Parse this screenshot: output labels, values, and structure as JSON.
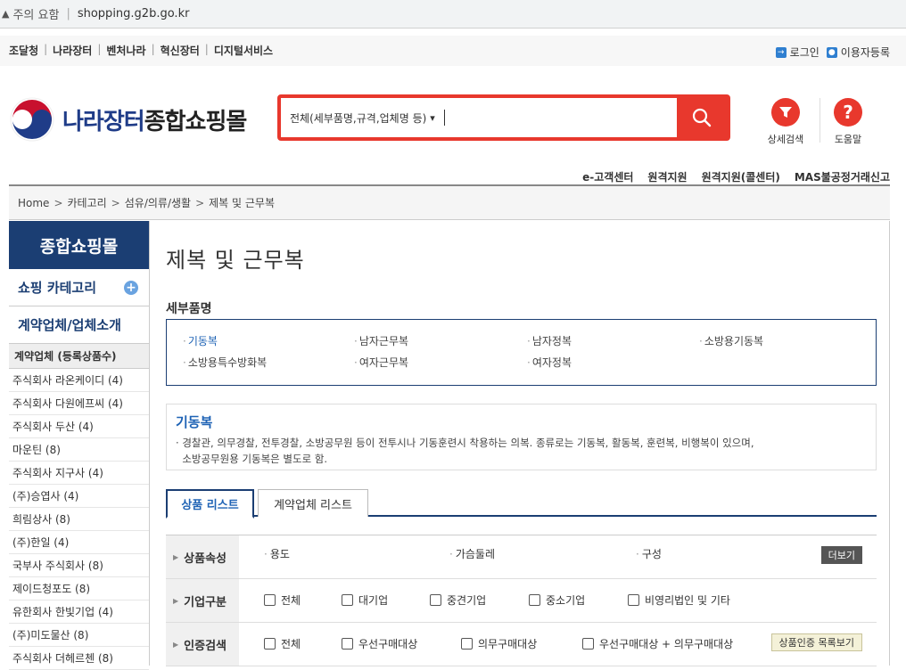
{
  "browser": {
    "warning": "주의 요함",
    "url": "shopping.g2b.go.kr"
  },
  "util": {
    "links": [
      "조달청",
      "나라장터",
      "벤처나라",
      "혁신장터",
      "디지털서비스"
    ],
    "login": "로그인",
    "register": "이용자등록"
  },
  "header": {
    "logo_blue": "나라장터",
    "logo_black": "종합쇼핑몰",
    "search_scope": "전체(세부품명,규격,업체명 등)",
    "search_value": "",
    "detail_search": "상세검색",
    "help": "도움말"
  },
  "sublinks": [
    "e-고객센터",
    "원격지원",
    "원격지원(콜센터)",
    "MAS불공정거래신고"
  ],
  "breadcrumb": [
    "Home",
    "카테고리",
    "섬유/의류/생활",
    "제복 및 근무복"
  ],
  "sidebar": {
    "title": "종합쇼핑몰",
    "category": "쇼핑 카테고리",
    "contract": "계약업체/업체소개",
    "list_header": "계약업체 (등록상품수)",
    "vendors": [
      "주식회사 라온케이디 (4)",
      "주식회사 다원에프씨 (4)",
      "주식회사 두산 (4)",
      "마운틴 (8)",
      "주식회사 지구사 (4)",
      "(주)승엽사 (4)",
      "희림상사 (8)",
      "(주)한일 (4)",
      "국부사 주식회사 (8)",
      "제이드청포도 (8)",
      "유한회사 한빛기업 (4)",
      "(주)미도물산 (8)",
      "주식회사 더헤르첸 (8)"
    ]
  },
  "main": {
    "title": "제복 및 근무복",
    "sub_title": "세부품명",
    "sub_items": [
      "기동복",
      "남자근무복",
      "남자정복",
      "소방용기동복",
      "소방용특수방화복",
      "여자근무복",
      "여자정복"
    ],
    "desc_title": "기동복",
    "desc_line1": "경찰관, 의무경찰, 전투경찰, 소방공무원 등이 전투시나 기동훈련시 착용하는 의복. 종류로는 기동복, 활동복, 훈련복, 비행복이 있으며,",
    "desc_line2": "소방공무원용 기동복은 별도로 함.",
    "tabs": [
      "상품 리스트",
      "계약업체 리스트"
    ],
    "filters": {
      "attr_label": "상품속성",
      "attr_values": [
        "용도",
        "가슴둘레",
        "구성"
      ],
      "more": "더보기",
      "company_label": "기업구분",
      "company_values": [
        "전체",
        "대기업",
        "중견기업",
        "중소기업",
        "비영리법인 및 기타"
      ],
      "cert_label": "인증검색",
      "cert_values": [
        "전체",
        "우선구매대상",
        "의무구매대상",
        "우선구매대상 + 의무구매대상"
      ],
      "cert_button": "상품인증 목록보기"
    }
  },
  "colors": {
    "brand_red": "#e8382d",
    "navy": "#1b3e73",
    "link_blue": "#1f63b5"
  }
}
